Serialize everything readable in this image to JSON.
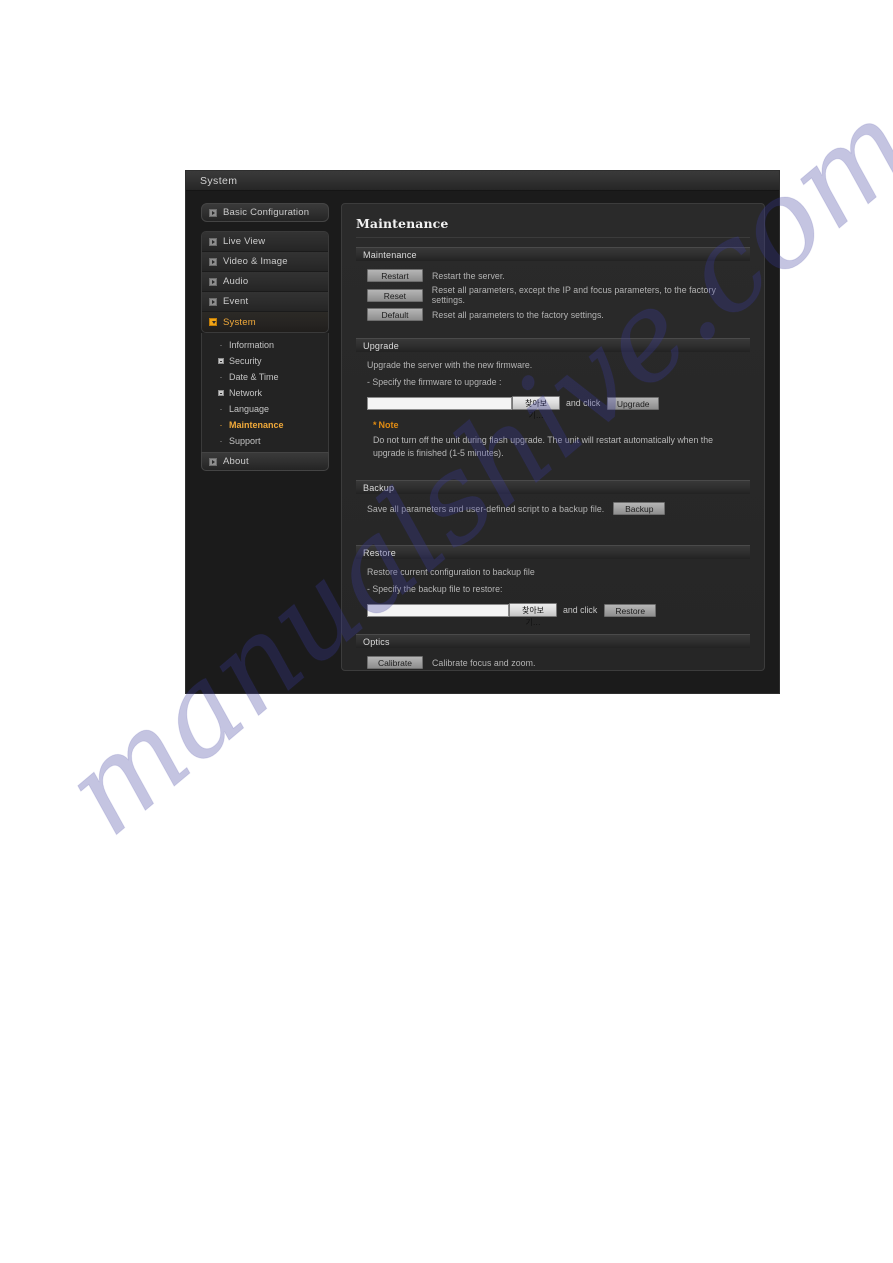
{
  "window": {
    "title": "System"
  },
  "sidebar": {
    "top_item": {
      "label": "Basic Configuration",
      "icon": "arrow-square-icon"
    },
    "items": [
      {
        "label": "Live View",
        "icon": "arrow-square-icon",
        "active": false
      },
      {
        "label": "Video & Image",
        "icon": "arrow-square-icon",
        "active": false
      },
      {
        "label": "Audio",
        "icon": "arrow-square-icon",
        "active": false
      },
      {
        "label": "Event",
        "icon": "arrow-square-icon",
        "active": false
      },
      {
        "label": "System",
        "icon": "arrow-square-icon-amber",
        "active": true
      }
    ],
    "sub_items": [
      {
        "label": "Information",
        "bullet": "dot",
        "active": false
      },
      {
        "label": "Security",
        "bullet": "expand-square",
        "active": false
      },
      {
        "label": "Date & Time",
        "bullet": "dot",
        "active": false
      },
      {
        "label": "Network",
        "bullet": "expand-square",
        "active": false
      },
      {
        "label": "Language",
        "bullet": "dot",
        "active": false
      },
      {
        "label": "Maintenance",
        "bullet": "dot",
        "active": true
      },
      {
        "label": "Support",
        "bullet": "dot",
        "active": false
      }
    ],
    "bottom_item": {
      "label": "About",
      "icon": "arrow-square-icon"
    }
  },
  "main": {
    "page_title": "Maintenance",
    "maintenance": {
      "header": "Maintenance",
      "rows": [
        {
          "button": "Restart",
          "desc": "Restart the server."
        },
        {
          "button": "Reset",
          "desc": "Reset all parameters, except the IP and focus parameters, to the factory settings."
        },
        {
          "button": "Default",
          "desc": "Reset all parameters to the factory settings."
        }
      ]
    },
    "upgrade": {
      "header": "Upgrade",
      "line1": "Upgrade the server with the new firmware.",
      "line2": "- Specify the firmware to upgrade :",
      "input_value": "",
      "browse_label": "찾아보기...",
      "and_click": "and click",
      "action_label": "Upgrade",
      "note_star": "*",
      "note_title": "Note",
      "note_body": "Do not turn off the unit during flash upgrade. The unit will restart automatically when the upgrade is finished (1-5 minutes)."
    },
    "backup": {
      "header": "Backup",
      "desc": "Save all parameters and user-defined script to a backup file.",
      "action_label": "Backup"
    },
    "restore": {
      "header": "Restore",
      "line1": "Restore current configuration to backup file",
      "line2": "- Specify the backup file to restore:",
      "input_value": "",
      "browse_label": "찾아보기...",
      "and_click": "and click",
      "action_label": "Restore"
    },
    "optics": {
      "header": "Optics",
      "action_label": "Calibrate",
      "desc": "Calibrate focus and zoom."
    }
  },
  "watermark": {
    "text": "manualshive.com",
    "color": "#3b3a9c"
  },
  "colors": {
    "accent": "#f0a93a",
    "note": "#e08b12",
    "panel": "#262626",
    "window": "#1b1b1b"
  }
}
